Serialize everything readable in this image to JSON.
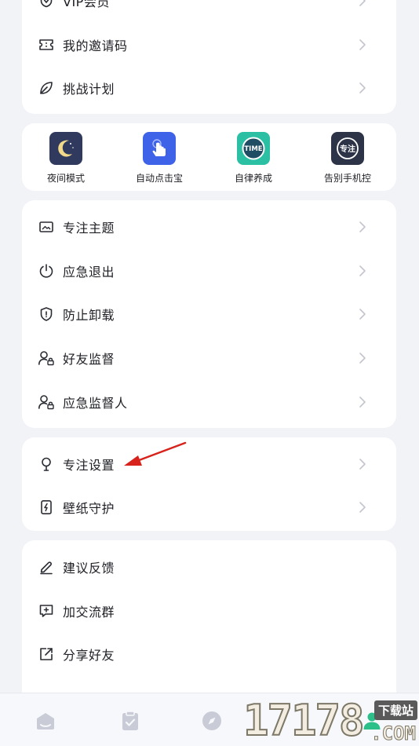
{
  "menu_top": {
    "items": [
      {
        "label": "VIP会员",
        "icon": "vip-shield-icon"
      },
      {
        "label": "我的邀请码",
        "icon": "ticket-icon"
      },
      {
        "label": "挑战计划",
        "icon": "leaf-icon"
      }
    ]
  },
  "tools": {
    "items": [
      {
        "label": "夜间模式",
        "icon": "moon-icon",
        "color": "#2f3a5e"
      },
      {
        "label": "自动点击宝",
        "icon": "tap-hand-icon",
        "color": "#3f63e8"
      },
      {
        "label": "自律养成",
        "icon": "time-icon",
        "color": "#2bbfa4",
        "badge": "TIME"
      },
      {
        "label": "告别手机控",
        "icon": "focus-badge-icon",
        "color": "#2d3448",
        "badge": "专注"
      }
    ]
  },
  "menu_focus": {
    "items": [
      {
        "label": "专注主题",
        "icon": "image-icon"
      },
      {
        "label": "应急退出",
        "icon": "power-icon"
      },
      {
        "label": "防止卸载",
        "icon": "shield-icon"
      },
      {
        "label": "好友监督",
        "icon": "user-lock-icon"
      },
      {
        "label": "应急监督人",
        "icon": "user-lock-icon"
      }
    ]
  },
  "menu_settings": {
    "items": [
      {
        "label": "专注设置",
        "icon": "bulb-icon"
      },
      {
        "label": "壁纸守护",
        "icon": "phone-bolt-icon"
      }
    ]
  },
  "menu_more": {
    "items": [
      {
        "label": "建议反馈",
        "icon": "pencil-icon"
      },
      {
        "label": "加交流群",
        "icon": "chat-plus-icon"
      },
      {
        "label": "分享好友",
        "icon": "share-icon"
      }
    ]
  },
  "tabbar": {
    "tabs": [
      {
        "icon": "home-icon"
      },
      {
        "icon": "clipboard-check-icon"
      },
      {
        "icon": "compass-icon"
      },
      {
        "icon": "profile-icon",
        "active": true
      }
    ]
  },
  "watermark": {
    "digits": "17178",
    "tag": "下载站",
    "domain": ".COM"
  },
  "colors": {
    "background": "#f1f3f7",
    "card": "#ffffff",
    "text": "#1e1f24",
    "icon": "#2a2c33",
    "chevron": "#c3c6cf",
    "arrow": "#d8221c",
    "tab_inactive": "#c9ccd6",
    "tab_active": "#2bbf8a"
  }
}
